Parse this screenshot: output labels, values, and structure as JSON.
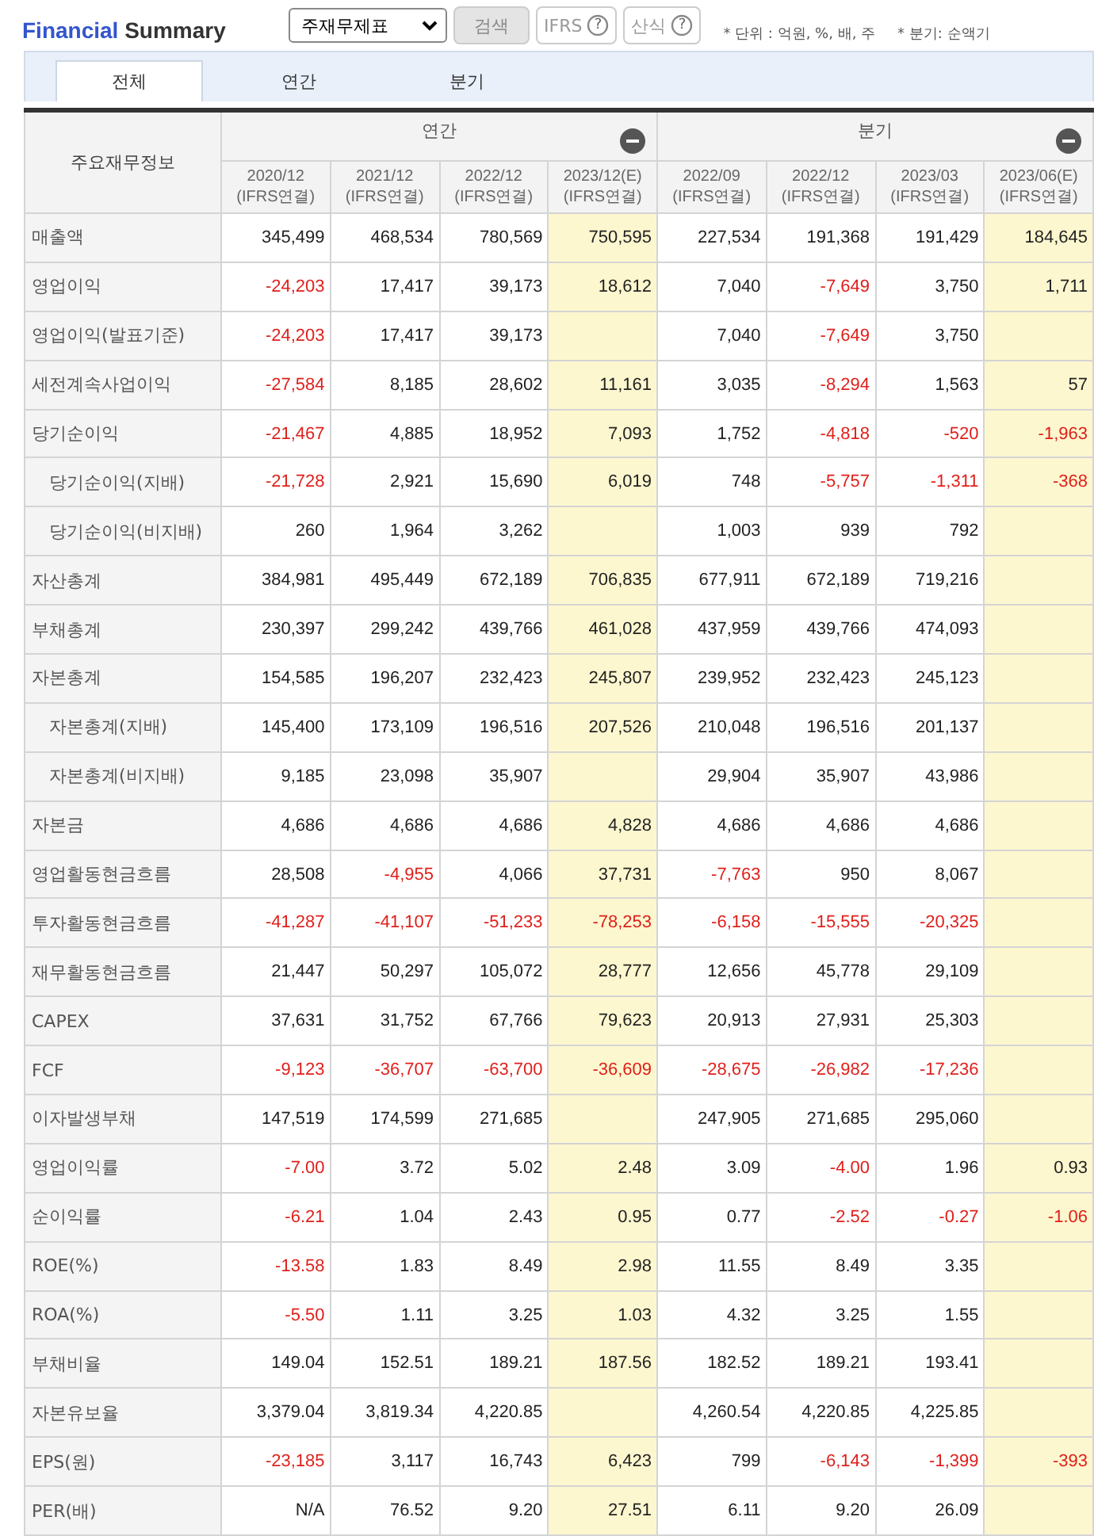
{
  "title": {
    "first": "Financial",
    "second": "Summary"
  },
  "statement_select": {
    "value": "주재무제표"
  },
  "buttons": [
    {
      "kind": "search",
      "label": "검색"
    },
    {
      "kind": "help",
      "label": "IFRS",
      "icon": "?"
    },
    {
      "kind": "help",
      "label": "산식",
      "icon": "?"
    }
  ],
  "notes": [
    "* 단위 : 억원, %, 배, 주",
    "* 분기: 순액기"
  ],
  "tabs": [
    {
      "label": "전체",
      "selected": true
    },
    {
      "label": "연간",
      "selected": false
    },
    {
      "label": "분기",
      "selected": false
    }
  ],
  "table": {
    "corner": "주요재무정보",
    "groups": [
      {
        "label": "연간",
        "columns": [
          {
            "period": "2020/12",
            "basis": "(IFRS연결)",
            "estimate": false
          },
          {
            "period": "2021/12",
            "basis": "(IFRS연결)",
            "estimate": false
          },
          {
            "period": "2022/12",
            "basis": "(IFRS연결)",
            "estimate": false
          },
          {
            "period": "2023/12(E)",
            "basis": "(IFRS연결)",
            "estimate": true
          }
        ]
      },
      {
        "label": "분기",
        "columns": [
          {
            "period": "2022/09",
            "basis": "(IFRS연결)",
            "estimate": false
          },
          {
            "period": "2022/12",
            "basis": "(IFRS연결)",
            "estimate": false
          },
          {
            "period": "2023/03",
            "basis": "(IFRS연결)",
            "estimate": false
          },
          {
            "period": "2023/06(E)",
            "basis": "(IFRS연결)",
            "estimate": true
          }
        ]
      }
    ],
    "rows": [
      {
        "label": "매출액",
        "cells": [
          {
            "value": "345,499",
            "negative": false
          },
          {
            "value": "468,534",
            "negative": false
          },
          {
            "value": "780,569",
            "negative": false
          },
          {
            "value": "750,595",
            "negative": false
          },
          {
            "value": "227,534",
            "negative": false
          },
          {
            "value": "191,368",
            "negative": false
          },
          {
            "value": "191,429",
            "negative": false
          },
          {
            "value": "184,645",
            "negative": false
          }
        ]
      },
      {
        "label": "영업이익",
        "cells": [
          {
            "value": "-24,203",
            "negative": true
          },
          {
            "value": "17,417",
            "negative": false
          },
          {
            "value": "39,173",
            "negative": false
          },
          {
            "value": "18,612",
            "negative": false
          },
          {
            "value": "7,040",
            "negative": false
          },
          {
            "value": "-7,649",
            "negative": true
          },
          {
            "value": "3,750",
            "negative": false
          },
          {
            "value": "1,711",
            "negative": false
          }
        ]
      },
      {
        "label": "영업이익(발표기준)",
        "cells": [
          {
            "value": "-24,203",
            "negative": true
          },
          {
            "value": "17,417",
            "negative": false
          },
          {
            "value": "39,173",
            "negative": false
          },
          null,
          {
            "value": "7,040",
            "negative": false
          },
          {
            "value": "-7,649",
            "negative": true
          },
          {
            "value": "3,750",
            "negative": false
          },
          null
        ]
      },
      {
        "label": "세전계속사업이익",
        "cells": [
          {
            "value": "-27,584",
            "negative": true
          },
          {
            "value": "8,185",
            "negative": false
          },
          {
            "value": "28,602",
            "negative": false
          },
          {
            "value": "11,161",
            "negative": false
          },
          {
            "value": "3,035",
            "negative": false
          },
          {
            "value": "-8,294",
            "negative": true
          },
          {
            "value": "1,563",
            "negative": false
          },
          {
            "value": "57",
            "negative": false
          }
        ]
      },
      {
        "label": "당기순이익",
        "cells": [
          {
            "value": "-21,467",
            "negative": true
          },
          {
            "value": "4,885",
            "negative": false
          },
          {
            "value": "18,952",
            "negative": false
          },
          {
            "value": "7,093",
            "negative": false
          },
          {
            "value": "1,752",
            "negative": false
          },
          {
            "value": "-4,818",
            "negative": true
          },
          {
            "value": "-520",
            "negative": true
          },
          {
            "value": "-1,963",
            "negative": true
          }
        ],
        "children": [
          {
            "label": "당기순이익(지배)",
            "cells": [
              {
                "value": "-21,728",
                "negative": true
              },
              {
                "value": "2,921",
                "negative": false
              },
              {
                "value": "15,690",
                "negative": false
              },
              {
                "value": "6,019",
                "negative": false
              },
              {
                "value": "748",
                "negative": false
              },
              {
                "value": "-5,757",
                "negative": true
              },
              {
                "value": "-1,311",
                "negative": true
              },
              {
                "value": "-368",
                "negative": true
              }
            ]
          },
          {
            "label": "당기순이익(비지배)",
            "cells": [
              {
                "value": "260",
                "negative": false
              },
              {
                "value": "1,964",
                "negative": false
              },
              {
                "value": "3,262",
                "negative": false
              },
              null,
              {
                "value": "1,003",
                "negative": false
              },
              {
                "value": "939",
                "negative": false
              },
              {
                "value": "792",
                "negative": false
              },
              null
            ]
          }
        ]
      },
      {
        "label": "자산총계",
        "cells": [
          {
            "value": "384,981",
            "negative": false
          },
          {
            "value": "495,449",
            "negative": false
          },
          {
            "value": "672,189",
            "negative": false
          },
          {
            "value": "706,835",
            "negative": false
          },
          {
            "value": "677,911",
            "negative": false
          },
          {
            "value": "672,189",
            "negative": false
          },
          {
            "value": "719,216",
            "negative": false
          },
          null
        ]
      },
      {
        "label": "부채총계",
        "cells": [
          {
            "value": "230,397",
            "negative": false
          },
          {
            "value": "299,242",
            "negative": false
          },
          {
            "value": "439,766",
            "negative": false
          },
          {
            "value": "461,028",
            "negative": false
          },
          {
            "value": "437,959",
            "negative": false
          },
          {
            "value": "439,766",
            "negative": false
          },
          {
            "value": "474,093",
            "negative": false
          },
          null
        ]
      },
      {
        "label": "자본총계",
        "cells": [
          {
            "value": "154,585",
            "negative": false
          },
          {
            "value": "196,207",
            "negative": false
          },
          {
            "value": "232,423",
            "negative": false
          },
          {
            "value": "245,807",
            "negative": false
          },
          {
            "value": "239,952",
            "negative": false
          },
          {
            "value": "232,423",
            "negative": false
          },
          {
            "value": "245,123",
            "negative": false
          },
          null
        ],
        "children": [
          {
            "label": "자본총계(지배)",
            "cells": [
              {
                "value": "145,400",
                "negative": false
              },
              {
                "value": "173,109",
                "negative": false
              },
              {
                "value": "196,516",
                "negative": false
              },
              {
                "value": "207,526",
                "negative": false
              },
              {
                "value": "210,048",
                "negative": false
              },
              {
                "value": "196,516",
                "negative": false
              },
              {
                "value": "201,137",
                "negative": false
              },
              null
            ]
          },
          {
            "label": "자본총계(비지배)",
            "cells": [
              {
                "value": "9,185",
                "negative": false
              },
              {
                "value": "23,098",
                "negative": false
              },
              {
                "value": "35,907",
                "negative": false
              },
              null,
              {
                "value": "29,904",
                "negative": false
              },
              {
                "value": "35,907",
                "negative": false
              },
              {
                "value": "43,986",
                "negative": false
              },
              null
            ]
          }
        ]
      },
      {
        "label": "자본금",
        "cells": [
          {
            "value": "4,686",
            "negative": false
          },
          {
            "value": "4,686",
            "negative": false
          },
          {
            "value": "4,686",
            "negative": false
          },
          {
            "value": "4,828",
            "negative": false
          },
          {
            "value": "4,686",
            "negative": false
          },
          {
            "value": "4,686",
            "negative": false
          },
          {
            "value": "4,686",
            "negative": false
          },
          null
        ]
      },
      {
        "label": "영업활동현금흐름",
        "cells": [
          {
            "value": "28,508",
            "negative": false
          },
          {
            "value": "-4,955",
            "negative": true
          },
          {
            "value": "4,066",
            "negative": false
          },
          {
            "value": "37,731",
            "negative": false
          },
          {
            "value": "-7,763",
            "negative": true
          },
          {
            "value": "950",
            "negative": false
          },
          {
            "value": "8,067",
            "negative": false
          },
          null
        ]
      },
      {
        "label": "투자활동현금흐름",
        "cells": [
          {
            "value": "-41,287",
            "negative": true
          },
          {
            "value": "-41,107",
            "negative": true
          },
          {
            "value": "-51,233",
            "negative": true
          },
          {
            "value": "-78,253",
            "negative": true
          },
          {
            "value": "-6,158",
            "negative": true
          },
          {
            "value": "-15,555",
            "negative": true
          },
          {
            "value": "-20,325",
            "negative": true
          },
          null
        ]
      },
      {
        "label": "재무활동현금흐름",
        "cells": [
          {
            "value": "21,447",
            "negative": false
          },
          {
            "value": "50,297",
            "negative": false
          },
          {
            "value": "105,072",
            "negative": false
          },
          {
            "value": "28,777",
            "negative": false
          },
          {
            "value": "12,656",
            "negative": false
          },
          {
            "value": "45,778",
            "negative": false
          },
          {
            "value": "29,109",
            "negative": false
          },
          null
        ]
      },
      {
        "label": "CAPEX",
        "cells": [
          {
            "value": "37,631",
            "negative": false
          },
          {
            "value": "31,752",
            "negative": false
          },
          {
            "value": "67,766",
            "negative": false
          },
          {
            "value": "79,623",
            "negative": false
          },
          {
            "value": "20,913",
            "negative": false
          },
          {
            "value": "27,931",
            "negative": false
          },
          {
            "value": "25,303",
            "negative": false
          },
          null
        ]
      },
      {
        "label": "FCF",
        "cells": [
          {
            "value": "-9,123",
            "negative": true
          },
          {
            "value": "-36,707",
            "negative": true
          },
          {
            "value": "-63,700",
            "negative": true
          },
          {
            "value": "-36,609",
            "negative": true
          },
          {
            "value": "-28,675",
            "negative": true
          },
          {
            "value": "-26,982",
            "negative": true
          },
          {
            "value": "-17,236",
            "negative": true
          },
          null
        ]
      },
      {
        "label": "이자발생부채",
        "cells": [
          {
            "value": "147,519",
            "negative": false
          },
          {
            "value": "174,599",
            "negative": false
          },
          {
            "value": "271,685",
            "negative": false
          },
          null,
          {
            "value": "247,905",
            "negative": false
          },
          {
            "value": "271,685",
            "negative": false
          },
          {
            "value": "295,060",
            "negative": false
          },
          null
        ]
      },
      {
        "label": "영업이익률",
        "cells": [
          {
            "value": "-7.00",
            "negative": true
          },
          {
            "value": "3.72",
            "negative": false
          },
          {
            "value": "5.02",
            "negative": false
          },
          {
            "value": "2.48",
            "negative": false
          },
          {
            "value": "3.09",
            "negative": false
          },
          {
            "value": "-4.00",
            "negative": true
          },
          {
            "value": "1.96",
            "negative": false
          },
          {
            "value": "0.93",
            "negative": false
          }
        ]
      },
      {
        "label": "순이익률",
        "cells": [
          {
            "value": "-6.21",
            "negative": true
          },
          {
            "value": "1.04",
            "negative": false
          },
          {
            "value": "2.43",
            "negative": false
          },
          {
            "value": "0.95",
            "negative": false
          },
          {
            "value": "0.77",
            "negative": false
          },
          {
            "value": "-2.52",
            "negative": true
          },
          {
            "value": "-0.27",
            "negative": true
          },
          {
            "value": "-1.06",
            "negative": true
          }
        ]
      },
      {
        "label": "ROE(%)",
        "cells": [
          {
            "value": "-13.58",
            "negative": true
          },
          {
            "value": "1.83",
            "negative": false
          },
          {
            "value": "8.49",
            "negative": false
          },
          {
            "value": "2.98",
            "negative": false
          },
          {
            "value": "11.55",
            "negative": false
          },
          {
            "value": "8.49",
            "negative": false
          },
          {
            "value": "3.35",
            "negative": false
          },
          null
        ]
      },
      {
        "label": "ROA(%)",
        "cells": [
          {
            "value": "-5.50",
            "negative": true
          },
          {
            "value": "1.11",
            "negative": false
          },
          {
            "value": "3.25",
            "negative": false
          },
          {
            "value": "1.03",
            "negative": false
          },
          {
            "value": "4.32",
            "negative": false
          },
          {
            "value": "3.25",
            "negative": false
          },
          {
            "value": "1.55",
            "negative": false
          },
          null
        ]
      },
      {
        "label": "부채비율",
        "cells": [
          {
            "value": "149.04",
            "negative": false
          },
          {
            "value": "152.51",
            "negative": false
          },
          {
            "value": "189.21",
            "negative": false
          },
          {
            "value": "187.56",
            "negative": false
          },
          {
            "value": "182.52",
            "negative": false
          },
          {
            "value": "189.21",
            "negative": false
          },
          {
            "value": "193.41",
            "negative": false
          },
          null
        ]
      },
      {
        "label": "자본유보율",
        "cells": [
          {
            "value": "3,379.04",
            "negative": false
          },
          {
            "value": "3,819.34",
            "negative": false
          },
          {
            "value": "4,220.85",
            "negative": false
          },
          null,
          {
            "value": "4,260.54",
            "negative": false
          },
          {
            "value": "4,220.85",
            "negative": false
          },
          {
            "value": "4,225.85",
            "negative": false
          },
          null
        ]
      },
      {
        "label": "EPS(원)",
        "cells": [
          {
            "value": "-23,185",
            "negative": true
          },
          {
            "value": "3,117",
            "negative": false
          },
          {
            "value": "16,743",
            "negative": false
          },
          {
            "value": "6,423",
            "negative": false
          },
          {
            "value": "799",
            "negative": false
          },
          {
            "value": "-6,143",
            "negative": true
          },
          {
            "value": "-1,399",
            "negative": true
          },
          {
            "value": "-393",
            "negative": true
          }
        ]
      },
      {
        "label": "PER(배)",
        "cells": [
          {
            "value": "N/A",
            "negative": false
          },
          {
            "value": "76.52",
            "negative": false
          },
          {
            "value": "9.20",
            "negative": false
          },
          {
            "value": "27.51",
            "negative": false
          },
          {
            "value": "6.11",
            "negative": false
          },
          {
            "value": "9.20",
            "negative": false
          },
          {
            "value": "26.09",
            "negative": false
          },
          null
        ]
      }
    ]
  }
}
